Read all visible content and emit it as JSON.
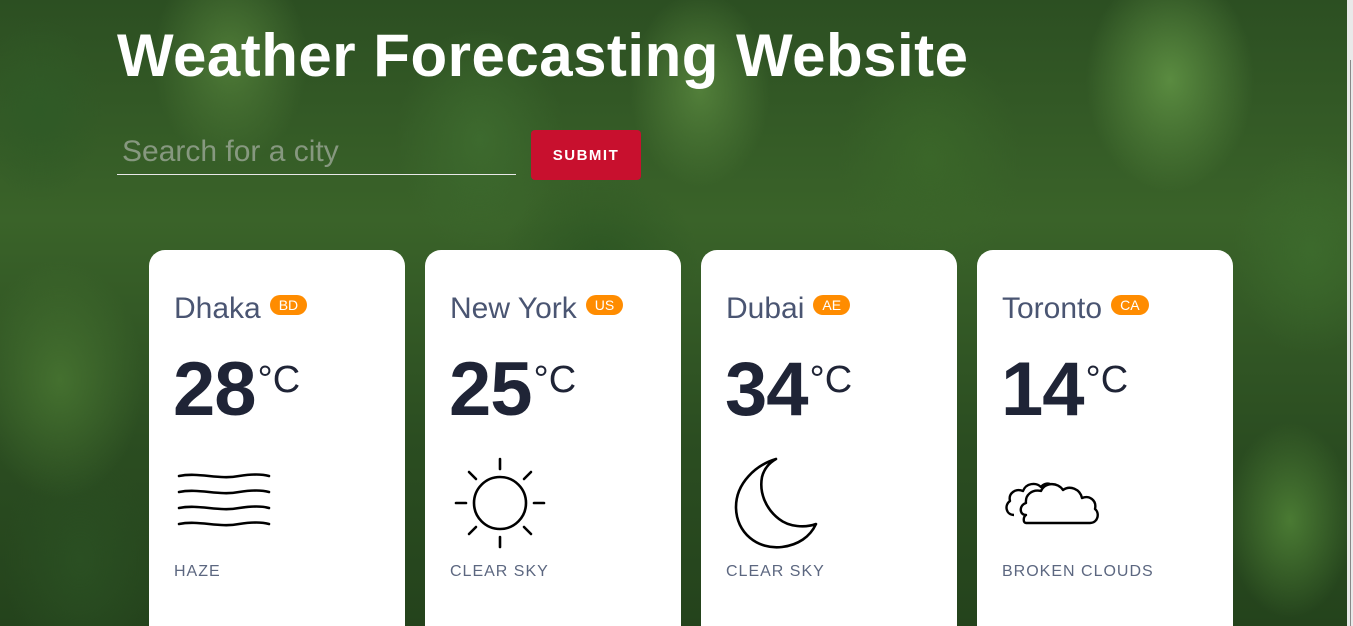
{
  "header": {
    "title": "Weather Forecasting Website"
  },
  "search": {
    "placeholder": "Search for a city",
    "value": "",
    "submit_label": "SUBMIT"
  },
  "colors": {
    "accent": "#c8102e",
    "badge": "#ff8c00",
    "card": "#ffffff"
  },
  "cities": [
    {
      "name": "Dhaka",
      "country": "BD",
      "temp": "28",
      "unit": "°C",
      "condition": "HAZE",
      "icon": "haze-icon"
    },
    {
      "name": "New York",
      "country": "US",
      "temp": "25",
      "unit": "°C",
      "condition": "CLEAR SKY",
      "icon": "sun-icon"
    },
    {
      "name": "Dubai",
      "country": "AE",
      "temp": "34",
      "unit": "°C",
      "condition": "CLEAR SKY",
      "icon": "moon-icon"
    },
    {
      "name": "Toronto",
      "country": "CA",
      "temp": "14",
      "unit": "°C",
      "condition": "BROKEN CLOUDS",
      "icon": "clouds-icon"
    }
  ]
}
